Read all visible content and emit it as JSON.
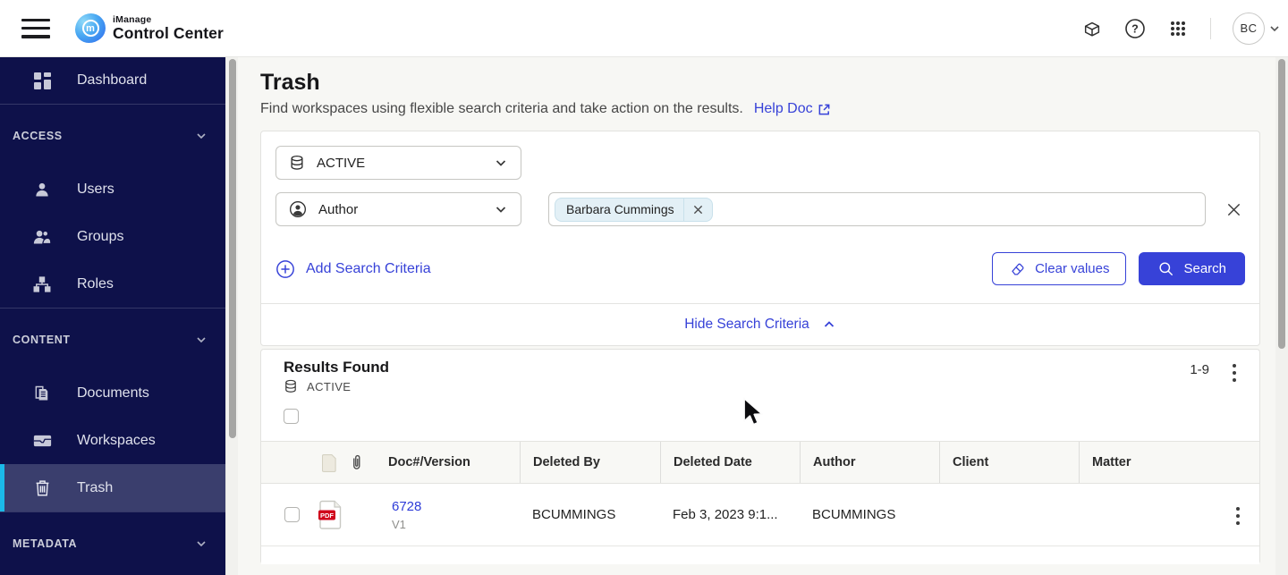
{
  "topbar": {
    "brand_small": "iManage",
    "brand_main": "Control Center",
    "avatar_initials": "BC"
  },
  "sidebar": {
    "dashboard_label": "Dashboard",
    "access_label": "ACCESS",
    "users_label": "Users",
    "groups_label": "Groups",
    "roles_label": "Roles",
    "content_label": "CONTENT",
    "documents_label": "Documents",
    "workspaces_label": "Workspaces",
    "trash_label": "Trash",
    "metadata_label": "METADATA"
  },
  "page": {
    "title": "Trash",
    "description": "Find workspaces using flexible search criteria and take action on the results.",
    "help_link_label": "Help Doc"
  },
  "search_panel": {
    "scope_value": "ACTIVE",
    "criteria_type_value": "Author",
    "criteria_chip": "Barbara Cummings",
    "add_criteria_label": "Add Search Criteria",
    "clear_values_label": "Clear values",
    "search_label": "Search",
    "hide_criteria_label": "Hide Search Criteria"
  },
  "results": {
    "title": "Results Found",
    "scope_label": "ACTIVE",
    "range_label": "1-9",
    "columns": {
      "doc": "Doc#/Version",
      "deleted_by": "Deleted By",
      "deleted_date": "Deleted Date",
      "author": "Author",
      "client": "Client",
      "matter": "Matter"
    },
    "rows": [
      {
        "doc_number": "6728",
        "version": "V1",
        "file_type": "PDF",
        "deleted_by": "BCUMMINGS",
        "deleted_date": "Feb 3, 2023 9:1...",
        "author": "BCUMMINGS",
        "client": "",
        "matter": ""
      }
    ]
  },
  "colors": {
    "accent_blue": "#3742d8",
    "sidebar_navy": "#0e114a",
    "selected_item_bg": "#3a3e6d",
    "selected_accent_cyan": "#1bb9e8",
    "pdf_badge_red": "#d0021b",
    "chip_bg": "#e3f0f6"
  }
}
